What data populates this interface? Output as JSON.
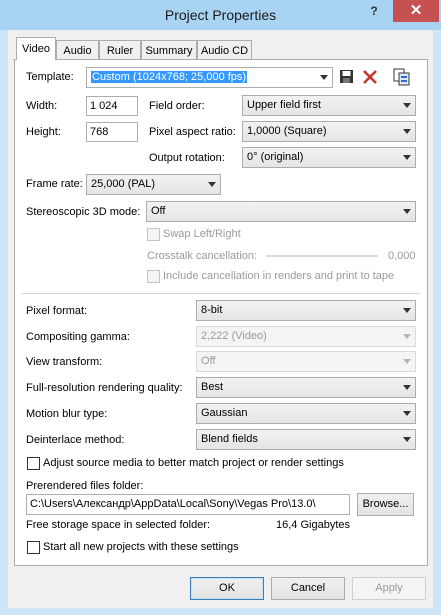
{
  "window": {
    "title": "Project Properties",
    "help_glyph": "?",
    "close_glyph": "✕"
  },
  "tabs": [
    "Video",
    "Audio",
    "Ruler",
    "Summary",
    "Audio CD"
  ],
  "video": {
    "template_label": "Template:",
    "template_value": "Custom (1024x768; 25,000 fps)",
    "width_label": "Width:",
    "width_value": "1 024",
    "height_label": "Height:",
    "height_value": "768",
    "field_order_label": "Field order:",
    "field_order_value": "Upper field first",
    "pixel_aspect_label": "Pixel aspect ratio:",
    "pixel_aspect_value": "1,0000 (Square)",
    "output_rotation_label": "Output rotation:",
    "output_rotation_value": "0° (original)",
    "frame_rate_label": "Frame rate:",
    "frame_rate_value": "25,000 (PAL)",
    "stereo_label": "Stereoscopic 3D mode:",
    "stereo_value": "Off",
    "swap_label": "Swap Left/Right",
    "crosstalk_label": "Crosstalk cancellation:",
    "crosstalk_value": "0,000",
    "include_cancel_label": "Include cancellation in renders and print to tape",
    "pixel_format_label": "Pixel format:",
    "pixel_format_value": "8-bit",
    "compositing_label": "Compositing gamma:",
    "compositing_value": "2,222 (Video)",
    "view_transform_label": "View transform:",
    "view_transform_value": "Off",
    "render_quality_label": "Full-resolution rendering quality:",
    "render_quality_value": "Best",
    "motion_blur_label": "Motion blur type:",
    "motion_blur_value": "Gaussian",
    "deinterlace_label": "Deinterlace method:",
    "deinterlace_value": "Blend fields",
    "adjust_source_label": "Adjust source media to better match project or render settings",
    "prerendered_label": "Prerendered files folder:",
    "prerendered_path": "C:\\Users\\Александр\\AppData\\Local\\Sony\\Vegas Pro\\13.0\\",
    "browse_label": "Browse...",
    "free_space_label": "Free storage space in selected folder:",
    "free_space_value": "16,4 Gigabytes",
    "start_all_label": "Start all new projects with these settings"
  },
  "buttons": {
    "ok": "OK",
    "cancel": "Cancel",
    "apply": "Apply"
  },
  "colors": {
    "titlebar": "#a9d3f2",
    "close": "#c75050",
    "selection": "#3399ff"
  }
}
